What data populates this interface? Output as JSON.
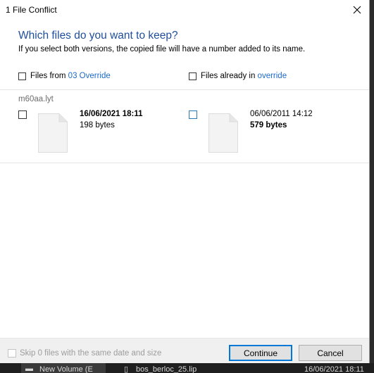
{
  "window": {
    "title": "1 File Conflict"
  },
  "header": {
    "question": "Which files do you want to keep?",
    "subtitle": "If you select both versions, the copied file will have a number added to its name."
  },
  "columns": {
    "left": {
      "prefix": "Files from ",
      "link": "03 Override"
    },
    "right": {
      "prefix": "Files already in ",
      "link": "override"
    }
  },
  "conflict": {
    "filename": "m60aa.lyt",
    "source": {
      "date": "16/06/2021 18:11",
      "size": "198 bytes"
    },
    "destination": {
      "date": "06/06/2011 14:12",
      "size": "579 bytes"
    }
  },
  "footer": {
    "skip_label": "Skip 0 files with the same date and size",
    "continue_label": "Continue",
    "cancel_label": "Cancel"
  },
  "taskbar": {
    "item1": "New Volume (E",
    "item2": "bos_berloc_25.lip",
    "item3": "16/06/2021 18:11"
  },
  "colors": {
    "accent": "#1f4e9c",
    "link": "#1b6ac9"
  }
}
